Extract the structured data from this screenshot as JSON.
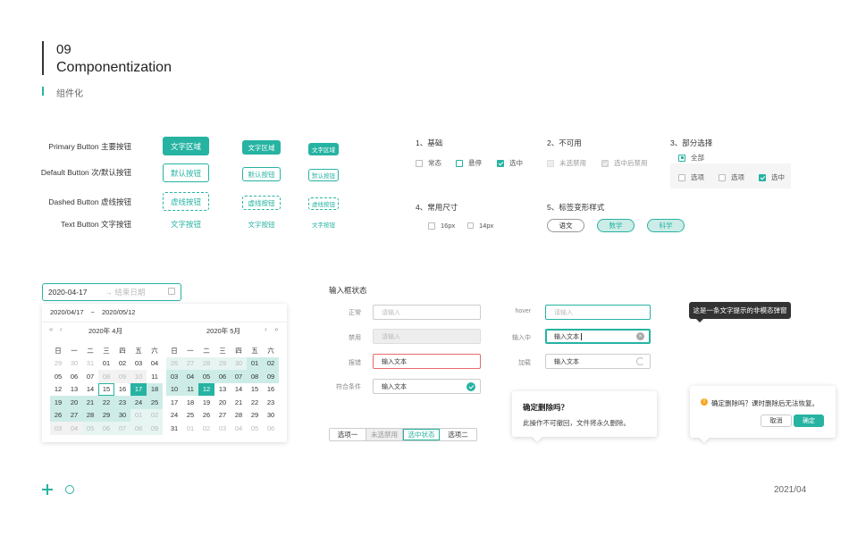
{
  "header": {
    "number": "09",
    "title": "Componentization",
    "subtitle": "组件化"
  },
  "buttons": {
    "primary_label": "Primary Button 主要按钮",
    "default_label": "Default Button 次/默认按钮",
    "dashed_label": "Dashed Button 虚线按钮",
    "text_label": "Text Button 文字按钮",
    "primary_text": "文字区域",
    "default_text": "默认按钮",
    "dashed_text": "虚线按钮",
    "text_text": "文字按钮"
  },
  "checkbox": {
    "basic": {
      "title": "1、基础",
      "items": [
        "常态",
        "悬停",
        "选中"
      ]
    },
    "disabled": {
      "title": "2、不可用",
      "items": [
        "未选禁用",
        "选中后禁用"
      ]
    },
    "partial": {
      "title": "3、部分选择",
      "all": "全部",
      "items": [
        "选项",
        "选项",
        "选中"
      ]
    },
    "sizes": {
      "title": "4、常用尺寸",
      "items": [
        "16px",
        "14px"
      ]
    }
  },
  "tags": {
    "title": "5、标签变形样式",
    "items": [
      "语文",
      "数学",
      "科学"
    ]
  },
  "date": {
    "start": "2020-04-17",
    "end_placeholder": "→ 结束日期",
    "range_start": "2020/04/17",
    "range_sep": "~",
    "range_end": "2020/05/12",
    "left_month": "2020年 4月",
    "right_month": "2020年 5月",
    "weekdays": [
      "日",
      "一",
      "二",
      "三",
      "四",
      "五",
      "六"
    ],
    "prev_year": "«",
    "prev_month": "‹",
    "next_month": "›",
    "next_year": "»"
  },
  "inputs": {
    "title": "输入框状态",
    "normal": {
      "label": "正常",
      "placeholder": "请输入"
    },
    "disabled": {
      "label": "禁用",
      "placeholder": "请输入"
    },
    "error": {
      "label": "报错",
      "value": "输入文本"
    },
    "valid": {
      "label": "符合条件",
      "value": "输入文本"
    },
    "hover": {
      "label": "hover",
      "placeholder": "请输入"
    },
    "typing": {
      "label": "输入中",
      "value": "输入文本"
    },
    "loading": {
      "label": "加载",
      "value": "输入文本"
    }
  },
  "segment": {
    "items": [
      "选项一",
      "未选禁用",
      "选中状态",
      "选项二"
    ]
  },
  "popover1": {
    "title": "确定删除吗？",
    "body": "此操作不可撤回，文件将永久删除。"
  },
  "popover2": {
    "body": "确定删除吗？课时删除后无法恢复。",
    "cancel": "取消",
    "ok": "确定"
  },
  "tooltip": {
    "text": "这是一条文字提示的非模态弹窗"
  },
  "footer": {
    "date": "2021/04"
  },
  "colors": {
    "accent": "#26b3a2",
    "error": "#e86a6a"
  }
}
